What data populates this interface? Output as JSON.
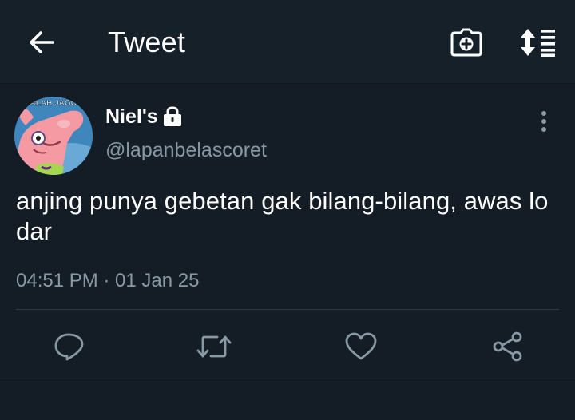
{
  "header": {
    "title": "Tweet",
    "back_icon": "arrow-left-icon",
    "camera_icon": "camera-plus-icon",
    "sort_icon": "sort-list-icon"
  },
  "tweet": {
    "display_name": "Niel's",
    "protected_icon": "lock-icon",
    "handle": "@lapanbelascoret",
    "avatar_text": "ALAH JAGO",
    "text": "anjing punya gebetan gak bilang-bilang, awas lo dar",
    "timestamp": "04:51 PM · 01 Jan 25",
    "more_icon": "more-vertical-icon"
  },
  "actions": [
    {
      "name": "reply",
      "icon": "reply-icon"
    },
    {
      "name": "retweet",
      "icon": "retweet-icon"
    },
    {
      "name": "like",
      "icon": "heart-icon"
    },
    {
      "name": "share",
      "icon": "share-icon"
    }
  ],
  "colors": {
    "background": "#141d26",
    "header": "#162029",
    "primary_text": "#ffffff",
    "secondary_text": "#8899a6",
    "icon": "#8899a6",
    "divider": "#2f3a45"
  }
}
